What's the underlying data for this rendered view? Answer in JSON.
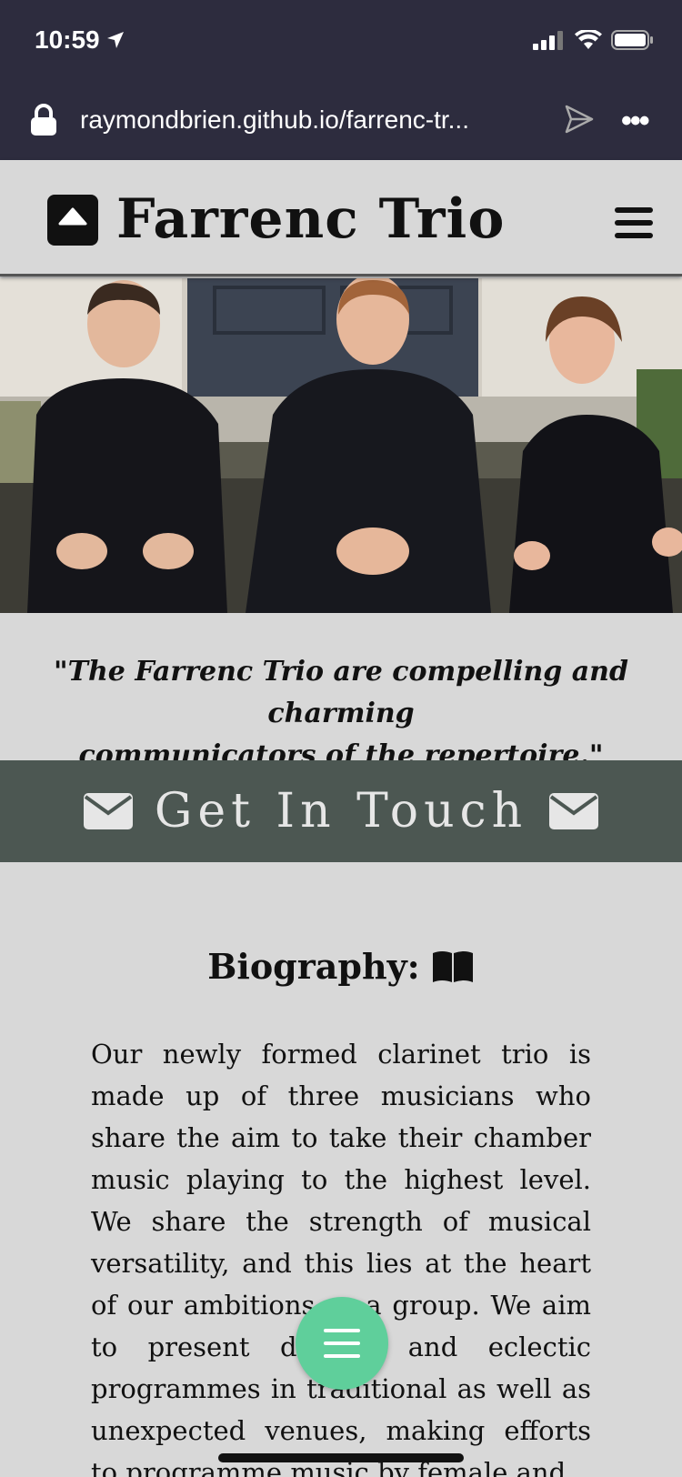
{
  "status_bar": {
    "time": "10:59"
  },
  "address_bar": {
    "url": "raymondbrien.github.io/farrenc-tr..."
  },
  "header": {
    "brand": "Farrenc Trio"
  },
  "hero": {},
  "quote": {
    "line1": "\"The Farrenc Trio are compelling and charming",
    "line2": "communicators of the repertoire.\""
  },
  "contact": {
    "label": "Get In Touch"
  },
  "biography": {
    "heading": "Biography:",
    "text": "Our newly formed clarinet trio is made up of three musicians who share the aim to take their chamber music playing to the highest level. We share the strength of musical versatility, and this lies at the heart of our ambitions as a group. We aim to present diverse and eclectic programmes in traditional as well as unexpected venues, making efforts to programme music by female and"
  },
  "colors": {
    "status_bar_bg": "#2d2c3e",
    "page_bg": "#d8d8d8",
    "contact_band_bg": "#4c5752",
    "fab_bg": "#5fcf9b"
  }
}
